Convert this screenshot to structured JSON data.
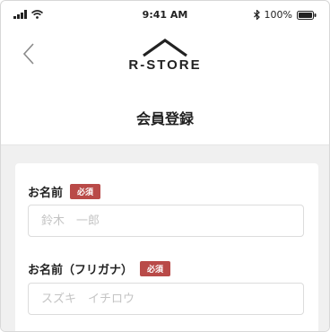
{
  "status_bar": {
    "time": "9:41 AM",
    "battery_text": "100%",
    "icons": [
      "signal-icon",
      "wifi-icon",
      "bluetooth-icon",
      "battery-icon"
    ]
  },
  "header": {
    "back_icon": "chevron-left-icon",
    "logo_text": "R-STORE",
    "title": "会員登録"
  },
  "form": {
    "fields": [
      {
        "label": "お名前",
        "required_badge": "必須",
        "placeholder": "鈴木　一郎",
        "value": ""
      },
      {
        "label": "お名前（フリガナ）",
        "required_badge": "必須",
        "placeholder": "スズキ　イチロウ",
        "value": ""
      }
    ]
  },
  "colors": {
    "badge": "#b94a48",
    "page_background": "#f0f0f0",
    "input_border": "#dcdcdc",
    "placeholder": "#c4c4c4"
  }
}
